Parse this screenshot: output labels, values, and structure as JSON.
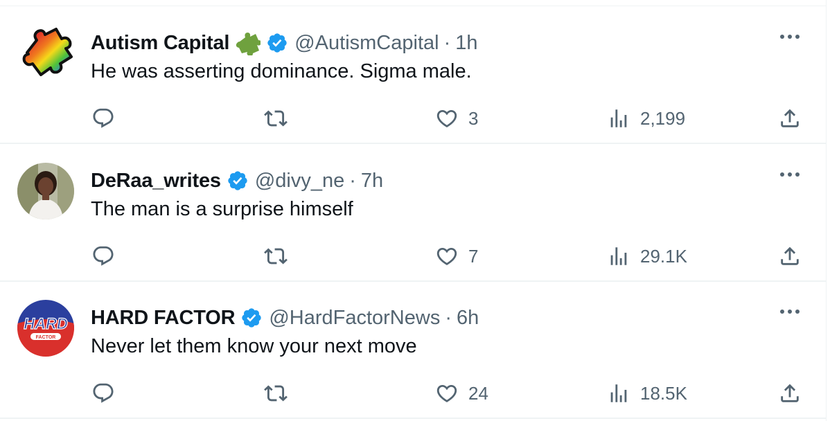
{
  "tweets": [
    {
      "display_name": "Autism Capital",
      "has_emoji": true,
      "handle": "@AutismCapital",
      "separator": "·",
      "time": "1h",
      "text": "He was asserting dominance. Sigma male.",
      "likes": "3",
      "views": "2,199",
      "avatar_icon": "rainbow-puzzle-piece-icon"
    },
    {
      "display_name": "DeRaa_writes",
      "has_emoji": false,
      "handle": "@divy_ne",
      "separator": "·",
      "time": "7h",
      "text": "The man is a surprise himself",
      "likes": "7",
      "views": "29.1K",
      "avatar_icon": "profile-photo"
    },
    {
      "display_name": "HARD FACTOR",
      "has_emoji": false,
      "handle": "@HardFactorNews",
      "separator": "·",
      "time": "6h",
      "text": "Never let them know your next move",
      "likes": "24",
      "views": "18.5K",
      "avatar_icon": "hard-factor-logo",
      "avatar_logo_text": "HARD",
      "avatar_logo_subtext": "FACTOR"
    }
  ],
  "colors": {
    "text_primary": "#0f1419",
    "text_secondary": "#536471",
    "verified": "#1d9bf0",
    "divider": "#eff3f4"
  }
}
